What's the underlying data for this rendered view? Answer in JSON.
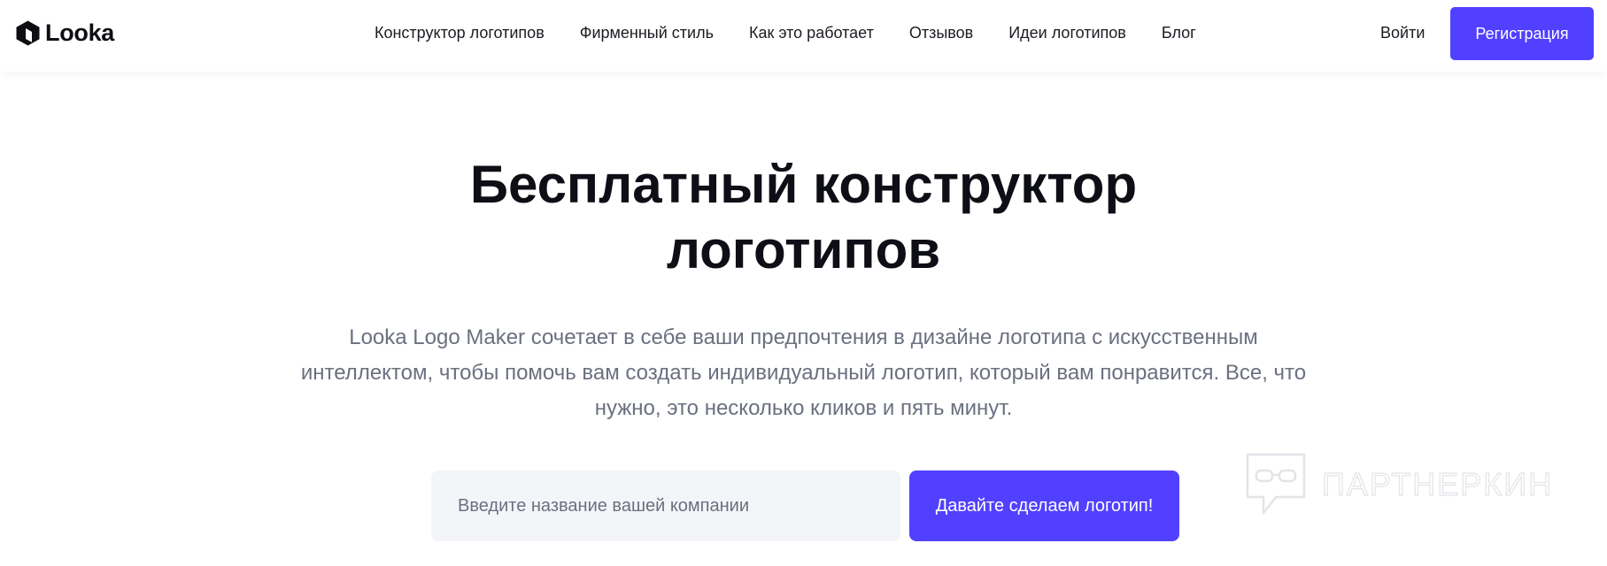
{
  "header": {
    "logo_text": "Looka",
    "nav": [
      {
        "label": "Конструктор логотипов"
      },
      {
        "label": "Фирменный стиль"
      },
      {
        "label": "Как это работает"
      },
      {
        "label": "Отзывов"
      },
      {
        "label": "Идеи логотипов"
      },
      {
        "label": "Блог"
      }
    ],
    "login_label": "Войти",
    "signup_label": "Регистрация"
  },
  "hero": {
    "title_line1": "Бесплатный конструктор",
    "title_line2": "логотипов",
    "subtitle": "Looka Logo Maker сочетает в себе ваши предпочтения в дизайне логотипа с искусственным интеллектом, чтобы помочь вам создать индивидуальный логотип, который вам понравится. Все, что нужно, это несколько кликов и пять минут.",
    "company_input_placeholder": "Введите название вашей компании",
    "cta_label": "Давайте сделаем логотип!"
  },
  "watermark": {
    "text": "ПАРТНЕРКИН",
    "icon": "chat-bubble-glasses-icon"
  },
  "colors": {
    "accent": "#5140ff",
    "text_dark": "#0e0f16",
    "text_muted": "#6b7080",
    "input_bg": "#f4f5f8"
  }
}
